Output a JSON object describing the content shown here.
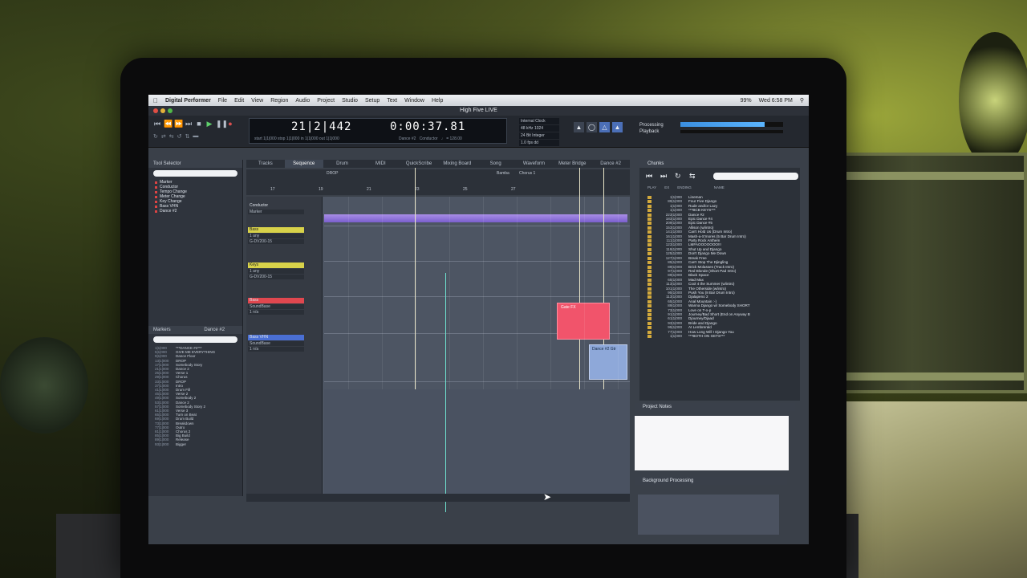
{
  "menubar": {
    "app": "Digital Performer",
    "items": [
      "File",
      "Edit",
      "View",
      "Region",
      "Audio",
      "Project",
      "Studio",
      "Setup",
      "Text",
      "Window",
      "Help"
    ],
    "battery": "99%",
    "clock": "Wed 6:58 PM"
  },
  "window": {
    "title": "High Five LIVE"
  },
  "counter": {
    "bars": "21|2|442",
    "time": "0:00:37.81",
    "sub_left": "start 1|1|000   stop 1|1|000   in 1|1|000   out 1|1|000",
    "chunk": "Dance #2",
    "conductor": "Conductor",
    "tempo": "128.00"
  },
  "clock_box": [
    "Internal Clock",
    "48 kHz  1024",
    "24 Bit Integer",
    "1.0 fps dd"
  ],
  "processing": {
    "line1": "Processing",
    "line2": "Playback",
    "level": 0.82
  },
  "tool_panel": {
    "title": "Tool Selector",
    "items": [
      "Marker",
      "Conductor",
      "Tempo Change",
      "Meter Change",
      "Key Change",
      "Bass VHN",
      "Dance #2"
    ]
  },
  "markers_panel": {
    "title": "Markers",
    "selector": "Dance #2",
    "rows": [
      {
        "t": "1|1|000",
        "n": "***DANCE #2***"
      },
      {
        "t": "5|1|000",
        "n": "GIVE ME EVERYTHING"
      },
      {
        "t": "9|1|000",
        "n": "Dance Floor"
      },
      {
        "t": "13|1|000",
        "n": "DROP"
      },
      {
        "t": "17|1|000",
        "n": "Somebody Story"
      },
      {
        "t": "21|1|000",
        "n": "Dance 2"
      },
      {
        "t": "25|1|000",
        "n": "Verse 1"
      },
      {
        "t": "29|1|000",
        "n": "Chorus"
      },
      {
        "t": "33|1|000",
        "n": "DROP"
      },
      {
        "t": "37|1|000",
        "n": "Intro"
      },
      {
        "t": "41|1|000",
        "n": "Drum Fill"
      },
      {
        "t": "45|1|000",
        "n": "Verse 2"
      },
      {
        "t": "49|1|000",
        "n": "Somebody 2"
      },
      {
        "t": "53|1|000",
        "n": "Dance 2"
      },
      {
        "t": "57|1|000",
        "n": "Somebody Story 2"
      },
      {
        "t": "61|1|000",
        "n": "Verse 3"
      },
      {
        "t": "65|1|000",
        "n": "Turn on Beat"
      },
      {
        "t": "69|1|000",
        "n": "Drum Build"
      },
      {
        "t": "73|1|000",
        "n": "Breakdown"
      },
      {
        "t": "77|1|000",
        "n": "Outro"
      },
      {
        "t": "81|1|000",
        "n": "Chorus 2"
      },
      {
        "t": "85|1|000",
        "n": "Big Build"
      },
      {
        "t": "89|1|000",
        "n": "Release"
      },
      {
        "t": "93|1|000",
        "n": "Bigger"
      }
    ]
  },
  "tabs": [
    "Tracks",
    "Sequence",
    "Drum",
    "MIDI",
    "QuickScribe",
    "Mixing Board",
    "Song",
    "Waveform",
    "Meter Bridge",
    "Dance #2"
  ],
  "active_tab": "Sequence",
  "ruler": {
    "numbers": [
      "17",
      "19",
      "21",
      "23",
      "25",
      "27"
    ]
  },
  "markers_on_ruler": [
    "DROP",
    "Bamba",
    "Chorus 1"
  ],
  "tracks": [
    {
      "name": "Conductor",
      "line1": "Marker"
    },
    {
      "name": "Bass",
      "line1": "1 any",
      "line2": "G-DV200-15"
    },
    {
      "name": "Keys",
      "line1": "1 any",
      "line2": "G-DV200-15"
    },
    {
      "name": "Bass",
      "line1": "SoundBase",
      "line2": "1 n/a"
    },
    {
      "name": "Bass VHN",
      "line1": "SoundBase",
      "line2": "1 n/a"
    }
  ],
  "clips": {
    "red": "Gate FX",
    "wave": "Dance #2 Gtr"
  },
  "chunks": {
    "title": "Chunks",
    "columns": [
      "PLAY",
      "EX",
      "ENDING",
      "NAME"
    ],
    "rows": [
      {
        "n": "1|1|000",
        "name": "Lineman"
      },
      {
        "n": "89|1|000",
        "name": "Four Five Django"
      },
      {
        "n": "1|1|000",
        "name": "Rude and/or Lazy"
      },
      {
        "n": "1|1|000",
        "name": "***BCB KEYS***"
      },
      {
        "n": "223|1|000",
        "name": "Dance #2"
      },
      {
        "n": "183|1|000",
        "name": "Epic Dance #4"
      },
      {
        "n": "209|1|000",
        "name": "Epic Dance #5"
      },
      {
        "n": "153|1|000",
        "name": "Allison (w/intro)"
      },
      {
        "n": "141|1|000",
        "name": "Can't Hold Us (Drum Intro)"
      },
      {
        "n": "161|1|000",
        "name": "Mash-a-S'mores (5 Bar Drum Intro)"
      },
      {
        "n": "111|1|000",
        "name": "Party Rock Anthem"
      },
      {
        "n": "123|1|000",
        "name": "LMFAOOOOOOO!!!"
      },
      {
        "n": "119|1|000",
        "name": "Shut Up and Django"
      },
      {
        "n": "125|1|000",
        "name": "Don't Django Me Down"
      },
      {
        "n": "127|1|000",
        "name": "Break Free"
      },
      {
        "n": "85|1|000",
        "name": "Can't Stop The Djingling"
      },
      {
        "n": "89|1|000",
        "name": "Brick Molasses (Track Intro)"
      },
      {
        "n": "97|1|000",
        "name": "Red Blonde (Short Pad Intro)"
      },
      {
        "n": "89|1|000",
        "name": "Black Space"
      },
      {
        "n": "65|1|000",
        "name": "Mad Max"
      },
      {
        "n": "113|1|000",
        "name": "Cool 4 the Summer (w/intro)"
      },
      {
        "n": "101|1|000",
        "name": "The Otherside (w/intro)"
      },
      {
        "n": "95|1|000",
        "name": "Push You (8 Bar Drum Intro)"
      },
      {
        "n": "113|1|000",
        "name": "Djalapeno 2"
      },
      {
        "n": "65|1|000",
        "name": "Anal Mountain :-)"
      },
      {
        "n": "89|1|000",
        "name": "Wanna Django w/ Somebody SHORT"
      },
      {
        "n": "73|1|000",
        "name": "Love on T-o-p"
      },
      {
        "n": "91|1|000",
        "name": "Journey/Bad Short (End on Anyway B"
      },
      {
        "n": "61|1|000",
        "name": "Djourney/Djaad"
      },
      {
        "n": "93|1|000",
        "name": "Bride and Django"
      },
      {
        "n": "95|1|000",
        "name": "At Lembrerald"
      },
      {
        "n": "77|1|000",
        "name": "How Long Will I Django You"
      },
      {
        "n": "1|1|000",
        "name": "***BOTH ON GETS***"
      }
    ]
  },
  "project_notes": {
    "title": "Project Notes"
  },
  "background_processing": {
    "title": "Background Processing"
  }
}
